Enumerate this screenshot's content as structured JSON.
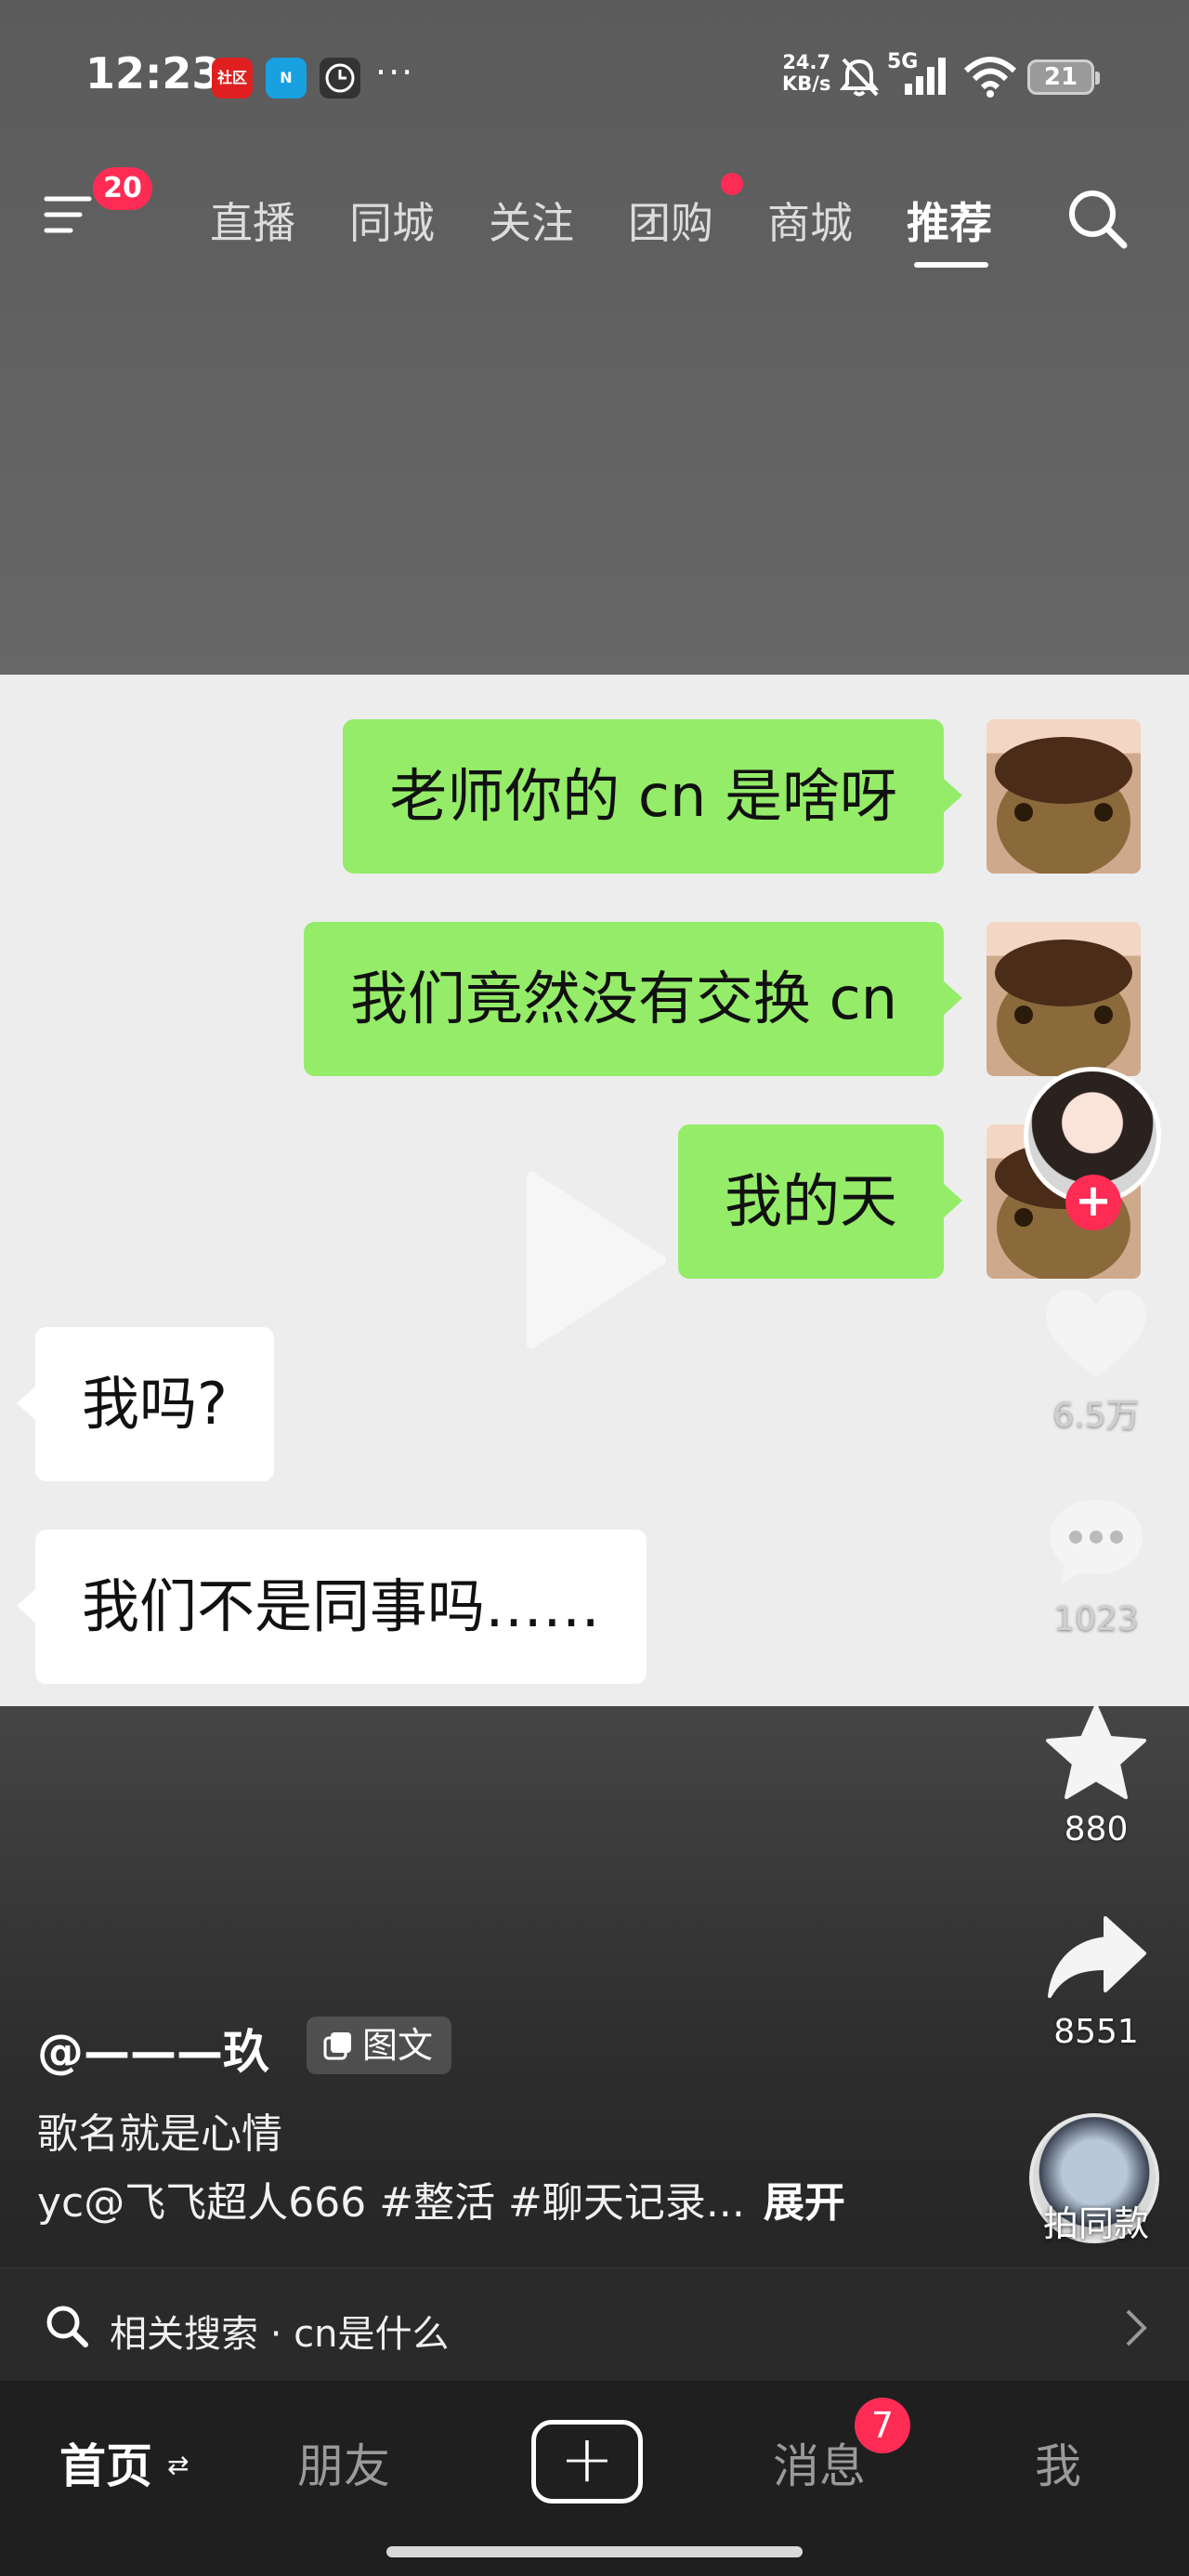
{
  "status_bar": {
    "time": "12:23",
    "app_badges": [
      "社区",
      "N",
      ""
    ],
    "more": "···",
    "net_speed_value": "24.7",
    "net_speed_unit": "KB/s",
    "network": "5G",
    "battery": "21",
    "icons": [
      "bell-off-icon",
      "signal-icon",
      "wifi-icon",
      "battery-icon"
    ]
  },
  "top_nav": {
    "menu_badge": "20",
    "tabs": [
      "直播",
      "同城",
      "关注",
      "团购",
      "商城",
      "推荐"
    ],
    "active_tab": "推荐"
  },
  "chat_image": {
    "messages": [
      {
        "side": "sent",
        "text": "老师你的 cn 是啥呀"
      },
      {
        "side": "sent",
        "text": "我们竟然没有交换 cn"
      },
      {
        "side": "sent",
        "text": "我的天"
      },
      {
        "side": "received",
        "text": "我吗?"
      },
      {
        "side": "received",
        "text": "我们不是同事吗……"
      }
    ]
  },
  "actions": {
    "likes": "6.5万",
    "comments": "1023",
    "favorites": "880",
    "shares": "8551",
    "music_label": "拍同款"
  },
  "post": {
    "author": "@———玖",
    "type_tag": "图文",
    "caption_line1": "歌名就是心情",
    "caption_line2": "yc@飞飞超人666 #整活 #聊天记录...",
    "expand": "展开"
  },
  "related_search": {
    "text": "相关搜索 · cn是什么"
  },
  "bottom_nav": {
    "items": [
      "首页",
      "朋友",
      "消息",
      "我"
    ],
    "swap": "⇄",
    "create_symbol": "+",
    "messages_badge": "7"
  },
  "colors": {
    "accent_red": "#fe2c55",
    "sent_bubble": "#95ec69",
    "received_bubble": "#ffffff"
  }
}
